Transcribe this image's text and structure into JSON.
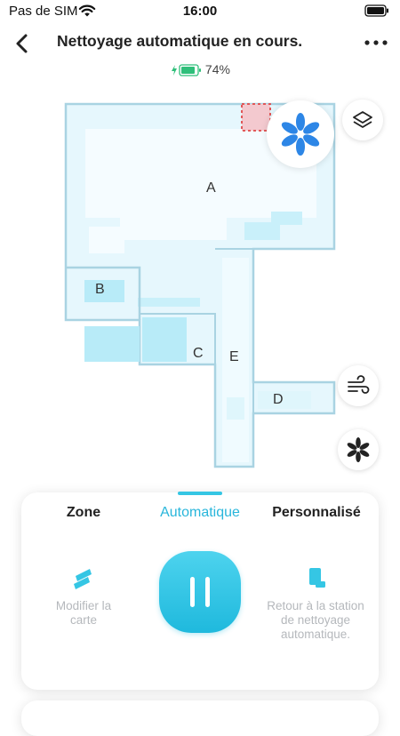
{
  "status_bar": {
    "carrier": "Pas de SIM",
    "time": "16:00"
  },
  "header": {
    "title": "Nettoyage automatique en cours.",
    "battery_percent": "74%"
  },
  "map": {
    "rooms": [
      "A",
      "B",
      "C",
      "D",
      "E"
    ]
  },
  "panel": {
    "tabs": [
      "Zone",
      "Automatique",
      "Personnalisé"
    ],
    "active_tab": "Automatique",
    "left_action": "Modifier la carte",
    "right_action": "Retour à la station de nettoyage automatique."
  },
  "colors": {
    "accent": "#29b6db",
    "map_fill": "#e6f7fd",
    "map_wall": "#a9d3e2"
  }
}
